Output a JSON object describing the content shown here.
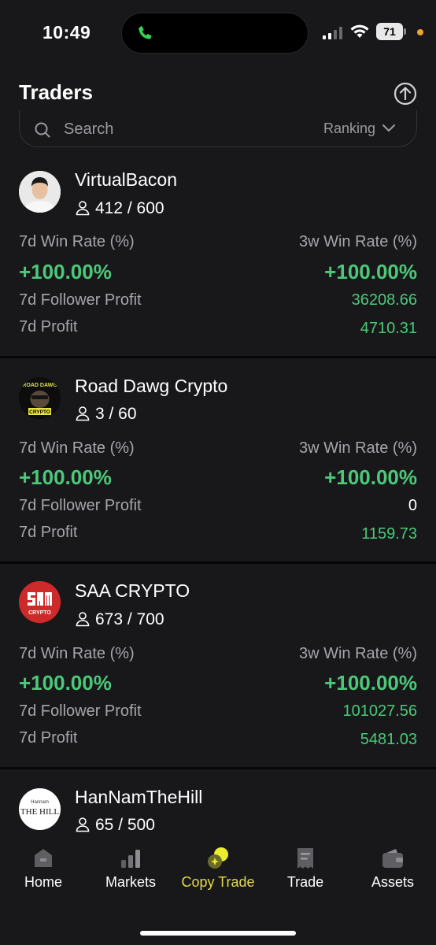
{
  "status_bar": {
    "time": "10:49",
    "battery": "71"
  },
  "header": {
    "title": "Traders"
  },
  "search": {
    "placeholder": "Search",
    "sort_label": "Ranking"
  },
  "labels": {
    "win_rate_7d": "7d Win Rate (%)",
    "win_rate_3w": "3w Win Rate (%)",
    "follower_profit_7d": "7d Follower Profit",
    "profit_7d": "7d Profit"
  },
  "traders": [
    {
      "name": "VirtualBacon",
      "followers": "412 / 600",
      "win_rate_7d": "+100.00%",
      "win_rate_3w": "+100.00%",
      "follower_profit_7d": "36208.66",
      "profit_7d": "4710.31"
    },
    {
      "name": "Road Dawg Crypto",
      "followers": "3 / 60",
      "win_rate_7d": "+100.00%",
      "win_rate_3w": "+100.00%",
      "follower_profit_7d": "0",
      "profit_7d": "1159.73",
      "logo_text_top": "ROAD DAWG",
      "logo_text_bottom": "CRYPTO"
    },
    {
      "name": "SAA CRYPTO",
      "followers": "673 / 700",
      "win_rate_7d": "+100.00%",
      "win_rate_3w": "+100.00%",
      "follower_profit_7d": "101027.56",
      "profit_7d": "5481.03",
      "logo_text": "CRYPTO"
    },
    {
      "name": "HanNamTheHill",
      "followers": "65 / 500",
      "logo_text_small": "Hannam",
      "logo_text": "THE HILL"
    }
  ],
  "nav": {
    "items": [
      {
        "label": "Home",
        "icon": "home-icon"
      },
      {
        "label": "Markets",
        "icon": "markets-icon"
      },
      {
        "label": "Copy Trade",
        "icon": "copy-trade-icon",
        "active": true
      },
      {
        "label": "Trade",
        "icon": "trade-icon"
      },
      {
        "label": "Assets",
        "icon": "wallet-icon"
      }
    ]
  },
  "colors": {
    "accent_green": "#4bc978",
    "active_yellow": "#e6d94a",
    "background": "#18181b"
  }
}
